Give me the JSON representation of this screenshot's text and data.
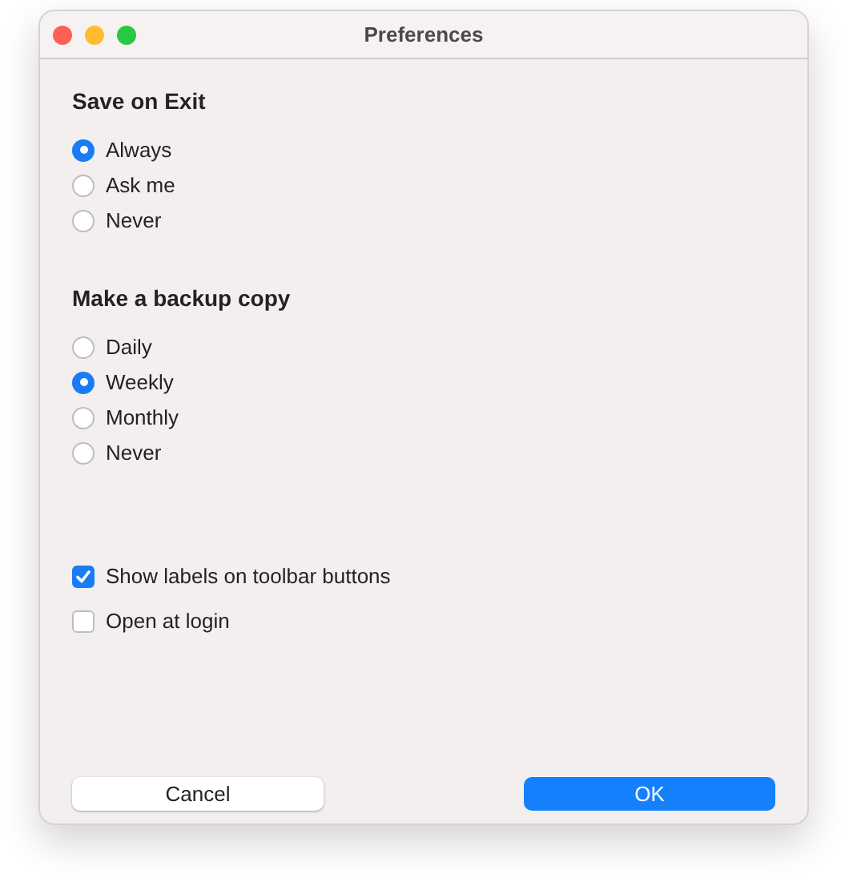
{
  "window": {
    "title": "Preferences"
  },
  "groups": [
    {
      "heading": "Save on Exit",
      "options": [
        {
          "label": "Always",
          "selected": true
        },
        {
          "label": "Ask me",
          "selected": false
        },
        {
          "label": "Never",
          "selected": false
        }
      ]
    },
    {
      "heading": "Make a backup copy",
      "options": [
        {
          "label": "Daily",
          "selected": false
        },
        {
          "label": "Weekly",
          "selected": true
        },
        {
          "label": "Monthly",
          "selected": false
        },
        {
          "label": "Never",
          "selected": false
        }
      ]
    }
  ],
  "checkboxes": [
    {
      "label": "Show labels on toolbar buttons",
      "checked": true
    },
    {
      "label": "Open at login",
      "checked": false
    }
  ],
  "buttons": [
    {
      "label": "Cancel",
      "kind": "secondary"
    },
    {
      "label": "OK",
      "kind": "primary"
    }
  ]
}
